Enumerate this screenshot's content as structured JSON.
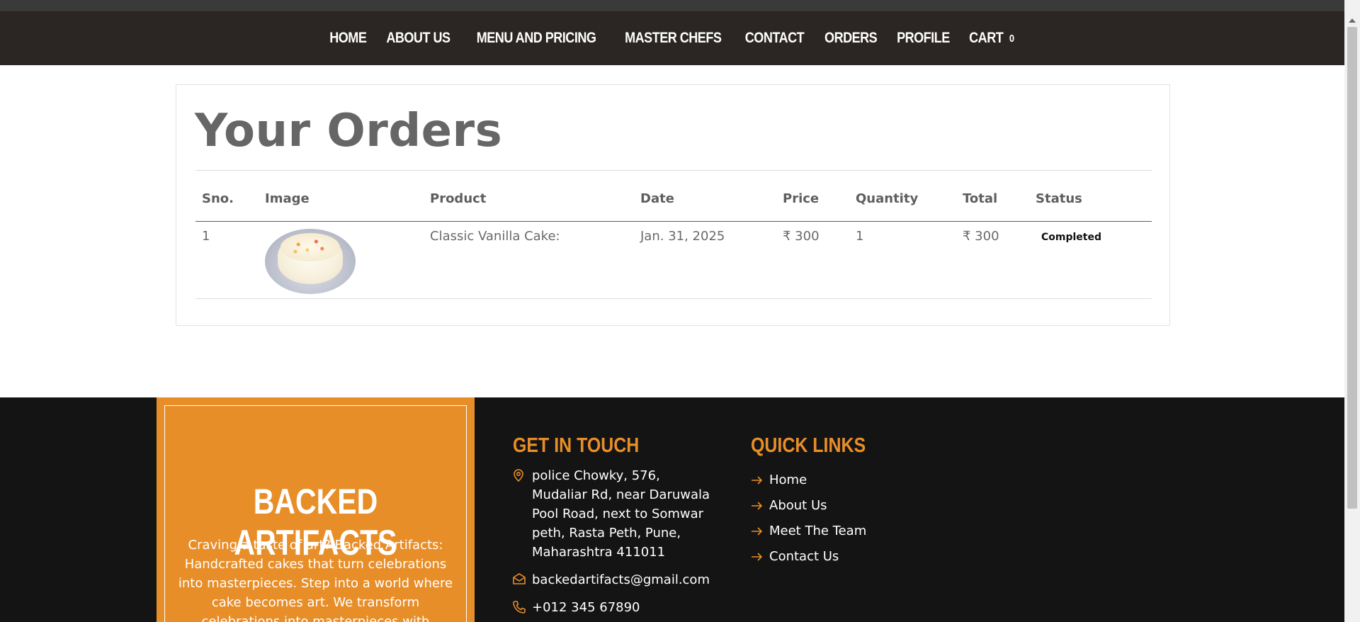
{
  "nav": {
    "items": [
      {
        "label": "HOME"
      },
      {
        "label": "ABOUT US"
      },
      {
        "label": "MENU AND PRICING"
      },
      {
        "label": "MASTER CHEFS"
      },
      {
        "label": "CONTACT"
      },
      {
        "label": "ORDERS"
      },
      {
        "label": "PROFILE"
      }
    ],
    "cart_label": "CART",
    "cart_count": "0"
  },
  "orders": {
    "title": "Your Orders",
    "columns": [
      "Sno.",
      "Image",
      "Product",
      "Date",
      "Price",
      "Quantity",
      "Total",
      "Status"
    ],
    "rows": [
      {
        "sno": "1",
        "image": "classic-vanilla-cake-photo",
        "product": "Classic Vanilla Cake:",
        "date": "Jan. 31, 2025",
        "price": "₹ 300",
        "quantity": "1",
        "total": "₹ 300",
        "status": "Completed"
      }
    ]
  },
  "footer": {
    "brand_title": "BACKED ARTIFACTS",
    "brand_text": "Craving a taste of art? Backed Artifacts: Handcrafted cakes that turn celebrations into masterpieces. Step into a world where cake becomes art. We transform celebrations into masterpieces with handcrafted cakes.",
    "touch_heading": "GET IN TOUCH",
    "address": "police Chowky, 576, Mudaliar Rd, near Daruwala Pool Road, next to Somwar peth, Rasta Peth, Pune, Maharashtra 411011",
    "email": "backedartifacts@gmail.com",
    "phone": "+012 345 67890",
    "links_heading": "QUICK LINKS",
    "links": [
      "Home",
      "About Us",
      "Meet The Team",
      "Contact Us"
    ]
  },
  "icons": {
    "address": "map-pin-icon",
    "email": "envelope-icon",
    "phone": "phone-icon",
    "link": "arrow-right-icon"
  },
  "colors": {
    "nav_bg": "#2b2623",
    "accent": "#e88e29",
    "footer_bg": "#141414"
  }
}
